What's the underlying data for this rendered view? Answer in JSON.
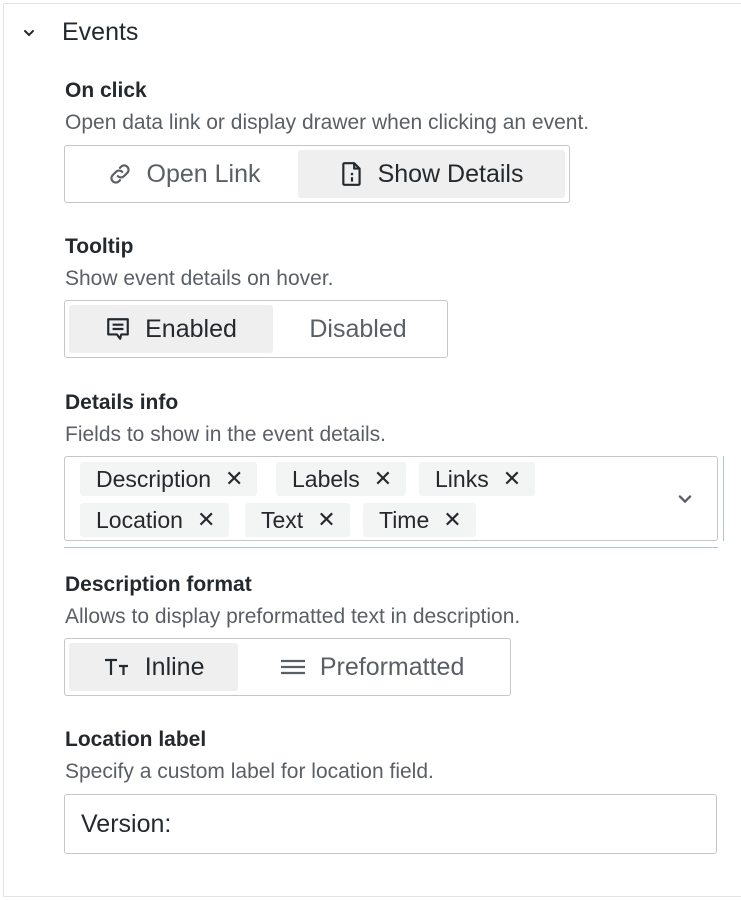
{
  "section": {
    "title": "Events",
    "expanded": true
  },
  "on_click": {
    "label": "On click",
    "description": "Open data link or display drawer when clicking an event.",
    "options": [
      {
        "label": "Open Link",
        "icon": "link-icon",
        "selected": false
      },
      {
        "label": "Show Details",
        "icon": "file-info-icon",
        "selected": true
      }
    ]
  },
  "tooltip": {
    "label": "Tooltip",
    "description": "Show event details on hover.",
    "options": [
      {
        "label": "Enabled",
        "icon": "comment-icon",
        "selected": true
      },
      {
        "label": "Disabled",
        "selected": false
      }
    ]
  },
  "details_info": {
    "label": "Details info",
    "description": "Fields to show in the event details.",
    "tags": [
      "Description",
      "Labels",
      "Links",
      "Location",
      "Text",
      "Time"
    ],
    "remove_glyph": "✕"
  },
  "description_format": {
    "label": "Description format",
    "description": "Allows to display preformatted text in description.",
    "options": [
      {
        "label": "Inline",
        "icon": "text-size-icon",
        "selected": true
      },
      {
        "label": "Preformatted",
        "icon": "align-justify-icon",
        "selected": false
      }
    ]
  },
  "location_label": {
    "label": "Location label",
    "description": "Specify a custom label for location field.",
    "value": "Version:"
  }
}
